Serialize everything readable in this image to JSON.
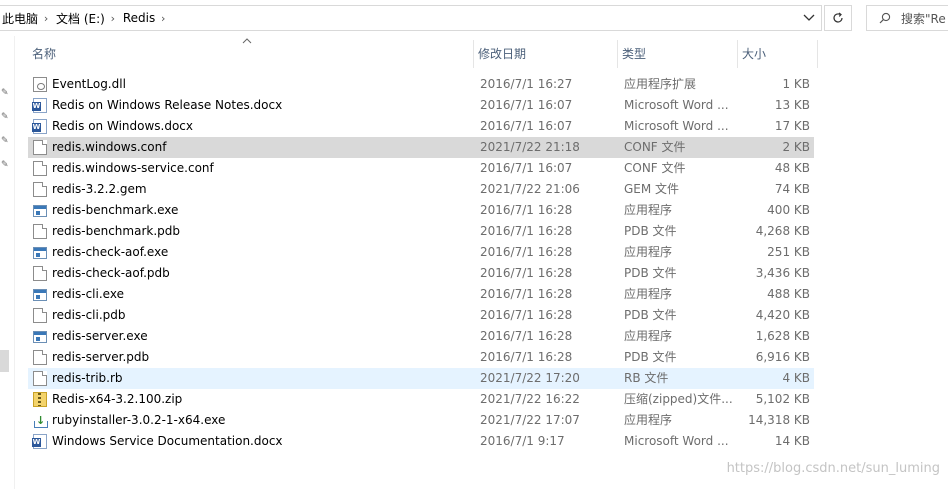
{
  "address": {
    "crumbs": [
      "此电脑",
      "文档 (E:)",
      "Redis"
    ],
    "separator": "›"
  },
  "search": {
    "placeholder": "搜索\"Re"
  },
  "icons": {
    "dropdown": "chevron-down-icon",
    "refresh": "refresh-icon",
    "search": "search-icon",
    "pin": "pin-icon"
  },
  "columns": {
    "name": "名称",
    "date": "修改日期",
    "type": "类型",
    "size": "大小"
  },
  "files": [
    {
      "name": "EventLog.dll",
      "date": "2016/7/1 16:27",
      "type": "应用程序扩展",
      "size": "1 KB",
      "icon": "dll"
    },
    {
      "name": "Redis on Windows Release Notes.docx",
      "date": "2016/7/1 16:07",
      "type": "Microsoft Word ...",
      "size": "13 KB",
      "icon": "word"
    },
    {
      "name": "Redis on Windows.docx",
      "date": "2016/7/1 16:07",
      "type": "Microsoft Word ...",
      "size": "17 KB",
      "icon": "word"
    },
    {
      "name": "redis.windows.conf",
      "date": "2021/7/22 21:18",
      "type": "CONF 文件",
      "size": "2 KB",
      "icon": "doc",
      "state": "selected"
    },
    {
      "name": "redis.windows-service.conf",
      "date": "2016/7/1 16:07",
      "type": "CONF 文件",
      "size": "48 KB",
      "icon": "doc"
    },
    {
      "name": "redis-3.2.2.gem",
      "date": "2021/7/22 21:06",
      "type": "GEM 文件",
      "size": "74 KB",
      "icon": "doc"
    },
    {
      "name": "redis-benchmark.exe",
      "date": "2016/7/1 16:28",
      "type": "应用程序",
      "size": "400 KB",
      "icon": "exe"
    },
    {
      "name": "redis-benchmark.pdb",
      "date": "2016/7/1 16:28",
      "type": "PDB 文件",
      "size": "4,268 KB",
      "icon": "doc"
    },
    {
      "name": "redis-check-aof.exe",
      "date": "2016/7/1 16:28",
      "type": "应用程序",
      "size": "251 KB",
      "icon": "exe"
    },
    {
      "name": "redis-check-aof.pdb",
      "date": "2016/7/1 16:28",
      "type": "PDB 文件",
      "size": "3,436 KB",
      "icon": "doc"
    },
    {
      "name": "redis-cli.exe",
      "date": "2016/7/1 16:28",
      "type": "应用程序",
      "size": "488 KB",
      "icon": "exe"
    },
    {
      "name": "redis-cli.pdb",
      "date": "2016/7/1 16:28",
      "type": "PDB 文件",
      "size": "4,420 KB",
      "icon": "doc"
    },
    {
      "name": "redis-server.exe",
      "date": "2016/7/1 16:28",
      "type": "应用程序",
      "size": "1,628 KB",
      "icon": "exe"
    },
    {
      "name": "redis-server.pdb",
      "date": "2016/7/1 16:28",
      "type": "PDB 文件",
      "size": "6,916 KB",
      "icon": "doc"
    },
    {
      "name": "redis-trib.rb",
      "date": "2021/7/22 17:20",
      "type": "RB 文件",
      "size": "4 KB",
      "icon": "doc",
      "state": "hover"
    },
    {
      "name": "Redis-x64-3.2.100.zip",
      "date": "2021/7/22 16:22",
      "type": "压缩(zipped)文件...",
      "size": "5,102 KB",
      "icon": "zip"
    },
    {
      "name": "rubyinstaller-3.0.2-1-x64.exe",
      "date": "2021/7/22 17:07",
      "type": "应用程序",
      "size": "14,318 KB",
      "icon": "inst"
    },
    {
      "name": "Windows Service Documentation.docx",
      "date": "2016/7/1 9:17",
      "type": "Microsoft Word ...",
      "size": "14 KB",
      "icon": "word"
    }
  ],
  "watermark": "https://blog.csdn.net/sun_luming"
}
